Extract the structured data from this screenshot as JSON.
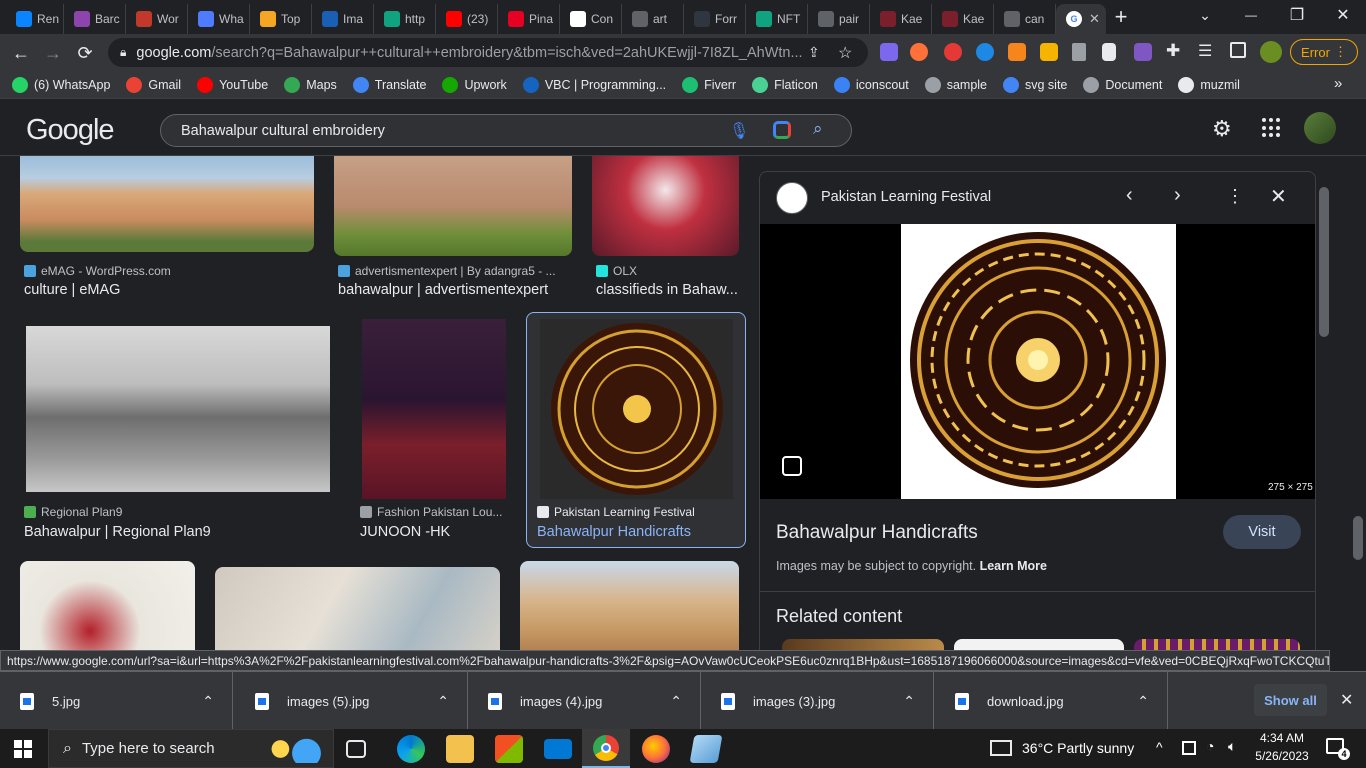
{
  "tabs": [
    {
      "label": "Ren",
      "color": "#0a84ff"
    },
    {
      "label": "Barc",
      "color": "#8e44ad"
    },
    {
      "label": "Wor",
      "color": "#c0392b"
    },
    {
      "label": "Wha",
      "color": "#4f7cff"
    },
    {
      "label": "Top",
      "color": "#f5a623"
    },
    {
      "label": "Ima",
      "color": "#1a5fb4"
    },
    {
      "label": "http",
      "color": "#10a37f"
    },
    {
      "label": "(23)",
      "color": "#ff0000"
    },
    {
      "label": "Pina",
      "color": "#e60023"
    },
    {
      "label": "Con",
      "color": "#ffffff"
    },
    {
      "label": "art",
      "color": "#5f6368"
    },
    {
      "label": "Forr",
      "color": "#2f3640"
    },
    {
      "label": "NFT",
      "color": "#10a37f"
    },
    {
      "label": "pair",
      "color": "#5f6368"
    },
    {
      "label": "Kae",
      "color": "#7a1f2b"
    },
    {
      "label": "Kae",
      "color": "#7a1f2b"
    },
    {
      "label": "can",
      "color": "#5f6368"
    }
  ],
  "active_tab": {
    "close": "✕"
  },
  "new_tab": "+",
  "window_controls": {
    "chevron": "⌄",
    "minimize": "—",
    "restore": "❐",
    "close": "✕"
  },
  "omnibox": {
    "host": "google.com",
    "path": "/search?q=Bahawalpur++cultural++embroidery&tbm=isch&ved=2ahUKEwjjl-7I8ZL_AhWtn..."
  },
  "error_button": "Error",
  "bookmarks": [
    {
      "label": "(6) WhatsApp",
      "color": "#25d366"
    },
    {
      "label": "Gmail",
      "color": "#ea4335"
    },
    {
      "label": "YouTube",
      "color": "#ff0000"
    },
    {
      "label": "Maps",
      "color": "#34a853"
    },
    {
      "label": "Translate",
      "color": "#4285f4"
    },
    {
      "label": "Upwork",
      "color": "#14a800"
    },
    {
      "label": "VBC | Programming...",
      "color": "#1565c0"
    },
    {
      "label": "Fiverr",
      "color": "#1dbf73"
    },
    {
      "label": "Flaticon",
      "color": "#4ad295"
    },
    {
      "label": "iconscout",
      "color": "#3b82f6"
    },
    {
      "label": "sample",
      "color": "#9aa0a6"
    },
    {
      "label": "svg site",
      "color": "#4285f4"
    },
    {
      "label": "Document",
      "color": "#9aa0a6"
    },
    {
      "label": "muzmil",
      "color": "#e8eaed"
    }
  ],
  "google": {
    "logo": "Google",
    "query": "Bahawalpur  cultural  embroidery"
  },
  "results": [
    {
      "source": "eMAG - WordPress.com",
      "caption": "culture | eMAG",
      "favcolor": "#4aa3df"
    },
    {
      "source": "advertismentexpert | By adangra5 - ...",
      "caption": "bahawalpur | advertismentexpert",
      "favcolor": "#4aa3df"
    },
    {
      "source": "OLX",
      "caption": "classifieds in Bahaw...",
      "favcolor": "#23e5db"
    },
    {
      "source": "Regional Plan9",
      "caption": "Bahawalpur | Regional Plan9",
      "favcolor": "#4caf50"
    },
    {
      "source": "Fashion Pakistan Lou...",
      "caption": "JUNOON -HK",
      "favcolor": "#9aa0a6"
    },
    {
      "source": "Pakistan Learning Festival",
      "caption": "Bahawalpur Handicrafts",
      "favcolor": "#e8eaed"
    }
  ],
  "panel": {
    "site": "Pakistan Learning Festival",
    "dims": "275 × 275",
    "title": "Bahawalpur Handicrafts",
    "visit": "Visit",
    "copyright": "Images may be subject to copyright.",
    "learn_more": "Learn More",
    "related": "Related content"
  },
  "status_url": "https://www.google.com/url?sa=i&url=https%3A%2F%2Fpakistanlearningfestival.com%2Fbahawalpur-handicrafts-3%2F&psig=AOvVaw0cUCeokPSE6uc0znrq1BHp&ust=1685187196066000&source=images&cd=vfe&ved=0CBEQjRxqFwoTCKCQtuTx...",
  "downloads": [
    {
      "name": "5.jpg"
    },
    {
      "name": "images (5).jpg"
    },
    {
      "name": "images (4).jpg"
    },
    {
      "name": "images (3).jpg"
    },
    {
      "name": "download.jpg"
    }
  ],
  "show_all": "Show all",
  "taskbar": {
    "search_placeholder": "Type here to search",
    "weather": "36°C  Partly sunny",
    "time": "4:34 AM",
    "date": "5/26/2023",
    "notifications": "4"
  }
}
